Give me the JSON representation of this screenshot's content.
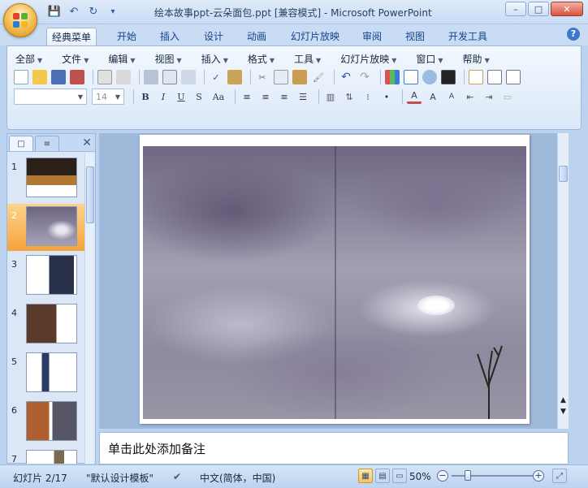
{
  "window": {
    "title": "绘本故事ppt-云朵面包.ppt [兼容模式] - Microsoft PowerPoint",
    "minimize": "–",
    "maximize": "□",
    "close": "✕"
  },
  "qat": {
    "save": "💾",
    "undo": "↶",
    "redo": "↻",
    "customize": "▾"
  },
  "tabs": [
    {
      "label": "经典菜单",
      "active": true
    },
    {
      "label": "开始"
    },
    {
      "label": "插入"
    },
    {
      "label": "设计"
    },
    {
      "label": "动画"
    },
    {
      "label": "幻灯片放映"
    },
    {
      "label": "审阅"
    },
    {
      "label": "视图"
    },
    {
      "label": "开发工具"
    }
  ],
  "help": "?",
  "menus": [
    "全部",
    "文件",
    "编辑",
    "视图",
    "插入",
    "格式",
    "工具",
    "幻灯片放映",
    "窗口",
    "帮助"
  ],
  "font": {
    "name": "",
    "size": "14"
  },
  "format_buttons": [
    "B",
    "I",
    "U",
    "S",
    "Aa"
  ],
  "slides_pane": {
    "tab_slides": "□",
    "tab_outline": "≡",
    "close": "✕",
    "items": [
      "1",
      "2",
      "3",
      "4",
      "5",
      "6",
      "7"
    ],
    "selected": "2"
  },
  "notes": {
    "placeholder": "单击此处添加备注"
  },
  "status": {
    "slide": "幻灯片 2/17",
    "template": "\"默认设计模板\"",
    "language": "中文(简体，中国)",
    "zoom": "50%",
    "zoom_out": "−",
    "zoom_in": "+"
  }
}
